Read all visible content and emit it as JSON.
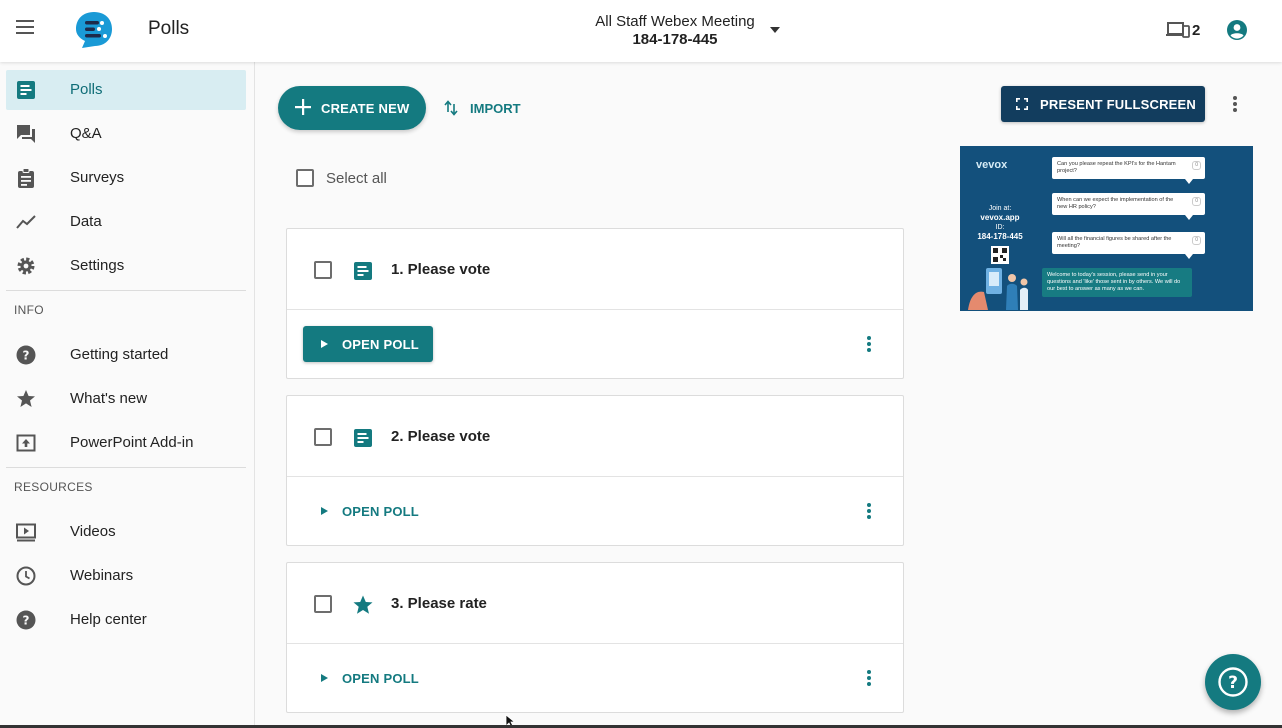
{
  "header": {
    "app_title": "Polls",
    "meeting_name": "All Staff Webex Meeting",
    "meeting_id": "184-178-445",
    "device_count": "2"
  },
  "sidebar": {
    "items": [
      {
        "label": "Polls",
        "icon": "poll-icon",
        "active": true
      },
      {
        "label": "Q&A",
        "icon": "forum-icon"
      },
      {
        "label": "Surveys",
        "icon": "clipboard-icon"
      },
      {
        "label": "Data",
        "icon": "trending-icon"
      },
      {
        "label": "Settings",
        "icon": "gear-icon"
      }
    ],
    "info_heading": "INFO",
    "info_items": [
      {
        "label": "Getting started",
        "icon": "help-circle-icon"
      },
      {
        "label": "What's new",
        "icon": "star-icon"
      },
      {
        "label": "PowerPoint Add-in",
        "icon": "upload-box-icon"
      }
    ],
    "resources_heading": "RESOURCES",
    "resources_items": [
      {
        "label": "Videos",
        "icon": "video-icon"
      },
      {
        "label": "Webinars",
        "icon": "clock-icon"
      },
      {
        "label": "Help center",
        "icon": "help-circle-icon"
      }
    ]
  },
  "toolbar": {
    "create_label": "CREATE NEW",
    "import_label": "IMPORT",
    "present_label": "PRESENT FULLSCREEN"
  },
  "list": {
    "select_all_label": "Select all",
    "polls": [
      {
        "title": "1. Please vote",
        "type": "text-poll",
        "action": "OPEN POLL",
        "highlighted": true
      },
      {
        "title": "2. Please vote",
        "type": "text-poll",
        "action": "OPEN POLL",
        "highlighted": false
      },
      {
        "title": "3. Please rate",
        "type": "rating",
        "action": "OPEN POLL",
        "highlighted": false
      }
    ]
  },
  "preview": {
    "brand": "vevox",
    "join_at": "Join at:",
    "join_url": "vevox.app",
    "id_label": "ID:",
    "id_value": "184-178-445",
    "questions": [
      "Can you please repeat the KPI's for the Hantam project?",
      "When can we expect the implementation of the new HR policy?",
      "Will all the financial figures be shared after the meeting?"
    ],
    "likes": [
      "0",
      "0",
      "0"
    ],
    "welcome": "Welcome to today's session, please send in your questions and 'like' those sent in by others. We will do our best to answer as many as we can."
  },
  "colors": {
    "accent": "#147a80",
    "present_bg": "#123d5e",
    "active_nav_bg": "#d8edf2",
    "preview_bg": "#13507c"
  }
}
